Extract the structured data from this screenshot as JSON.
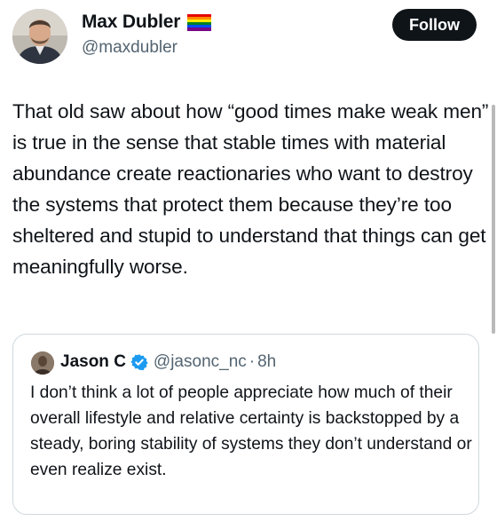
{
  "author": {
    "name": "Max Dubler",
    "handle": "@maxdubler",
    "flag_icon": "rainbow-flag-icon",
    "flag_colors": [
      "#e40303",
      "#ff8c00",
      "#ffed00",
      "#008026",
      "#004dff",
      "#750787"
    ]
  },
  "follow_label": "Follow",
  "tweet": {
    "text": "That old saw about how “good times make weak men” is true in the sense that stable times with material abundance create reactionaries who want to destroy the systems that protect them because they’re too sheltered and stupid to understand that things can get meaningfully worse."
  },
  "quote": {
    "name": "Jason C",
    "verified_icon": "verified-badge-icon",
    "handle": "@jasonc_nc",
    "separator": "·",
    "time": "8h",
    "text": "I don’t think a lot of people appreciate how much of their overall lifestyle and relative certainty is backstopped by a steady, boring stability of systems they don’t understand or even realize exist."
  },
  "colors": {
    "text": "#0f1419",
    "secondary": "#536471",
    "verified": "#1d9bf0",
    "button_bg": "#0f1419"
  }
}
